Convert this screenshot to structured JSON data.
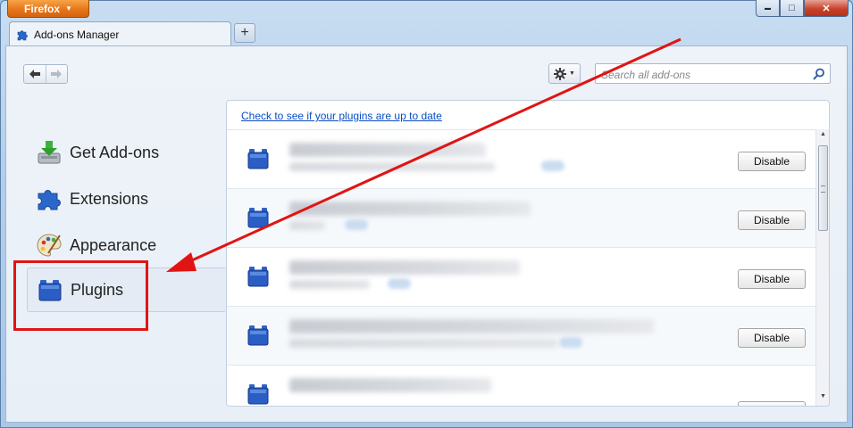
{
  "window": {
    "firefox_button_label": "Firefox",
    "caption_buttons": {
      "minimize": "▬",
      "maximize": "□",
      "close": "✕"
    }
  },
  "tab": {
    "title": "Add-ons Manager",
    "new_tab_label": "+"
  },
  "toolbar": {
    "back_label": "🡐",
    "forward_label": "🡒",
    "tools_icon": "gear-icon",
    "search": {
      "placeholder": "Search all add-ons",
      "value": ""
    }
  },
  "categories": [
    {
      "label": "Get Add-ons",
      "icon": "download-icon"
    },
    {
      "label": "Extensions",
      "icon": "puzzle-icon"
    },
    {
      "label": "Appearance",
      "icon": "palette-icon"
    },
    {
      "label": "Plugins",
      "icon": "plugin-brick-icon",
      "selected": true
    }
  ],
  "plugins": {
    "check_link": "Check to see if your plugins are up to date",
    "items": [
      {
        "action_label": "Disable"
      },
      {
        "action_label": "Disable"
      },
      {
        "action_label": "Disable"
      },
      {
        "action_label": "Disable"
      },
      {
        "action_label": ""
      }
    ]
  },
  "annotation": {
    "color": "#e11414"
  }
}
